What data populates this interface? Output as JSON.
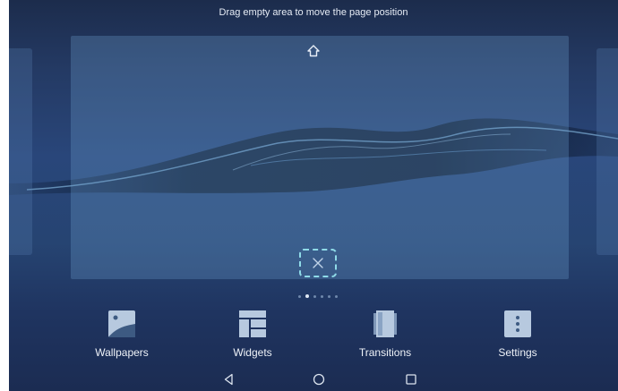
{
  "header": {
    "hint_text": "Drag empty area to move the page position"
  },
  "page": {
    "home_icon": "home-icon",
    "remove_icon": "close-icon",
    "page_count": 6,
    "current_page": 2
  },
  "dock": {
    "items": [
      {
        "label": "Wallpapers",
        "icon": "wallpaper-icon"
      },
      {
        "label": "Widgets",
        "icon": "widgets-icon"
      },
      {
        "label": "Transitions",
        "icon": "transitions-icon"
      },
      {
        "label": "Settings",
        "icon": "settings-icon"
      }
    ]
  },
  "navbar": {
    "back_icon": "back-icon",
    "home_icon": "home-circle-icon",
    "recents_icon": "recents-icon"
  },
  "colors": {
    "accent": "#8fdbe8",
    "background": "#243a64",
    "text": "#eef2f8"
  }
}
